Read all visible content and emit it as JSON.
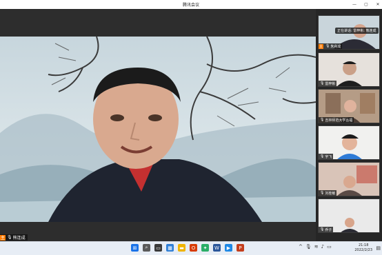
{
  "window": {
    "title": "腾讯会议",
    "controls": [
      "—",
      "▢",
      "✕"
    ]
  },
  "main_speaker": {
    "name": "熊连成",
    "badge": "主",
    "mic_icon": "microphone-icon"
  },
  "sidebar": {
    "speaking_label": "正在讲话: 雷梓彬; 熊连成",
    "tiles": [
      {
        "name": "朱舟成",
        "host": true
      },
      {
        "name": "雷梓彬"
      },
      {
        "name": "吉林师范大学丛福"
      },
      {
        "name": "宇飞"
      },
      {
        "name": "刘桂敏"
      },
      {
        "name": "乔子"
      }
    ]
  },
  "taskbar": {
    "icons": [
      {
        "name": "start-icon",
        "color": "#1a73e8",
        "glyph": "⊞"
      },
      {
        "name": "search-icon",
        "color": "#5a5a5a",
        "glyph": "⌕"
      },
      {
        "name": "task-view-icon",
        "color": "#3a3a3a",
        "glyph": "▭"
      },
      {
        "name": "widgets-icon",
        "color": "#2f7fd6",
        "glyph": "▦"
      },
      {
        "name": "explorer-icon",
        "color": "#f0b400",
        "glyph": "▬"
      },
      {
        "name": "office-icon",
        "color": "#d83b01",
        "glyph": "O"
      },
      {
        "name": "wechat-icon",
        "color": "#2aae67",
        "glyph": "✦"
      },
      {
        "name": "word-icon",
        "color": "#2b579a",
        "glyph": "W"
      },
      {
        "name": "meeting-icon",
        "color": "#1e88e5",
        "glyph": "▶"
      },
      {
        "name": "powerpoint-icon",
        "color": "#c43e1c",
        "glyph": "P"
      }
    ],
    "time": "21:18",
    "date": "2022/2/23"
  }
}
